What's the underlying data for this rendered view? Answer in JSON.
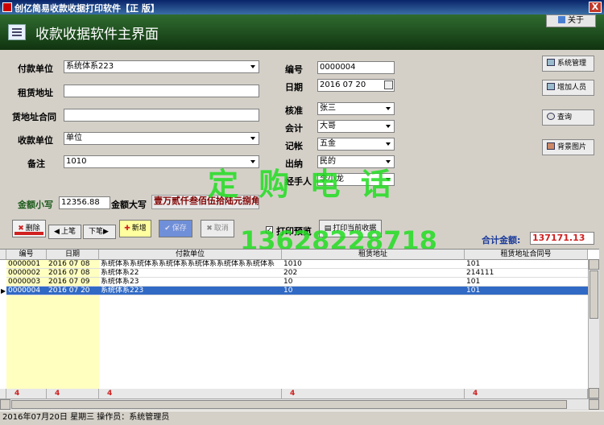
{
  "window": {
    "title": "创亿简易收款收据打印软件【正 版】",
    "close_label": "X"
  },
  "header": {
    "title": "收款收据软件主界面",
    "about_label": "关于"
  },
  "form": {
    "payer_label": "付款单位",
    "payer_value": "系统体系223",
    "rent_addr_label": "租赁地址",
    "rent_addr_value": "",
    "contract_label": "赁地址合同",
    "contract_value": "",
    "payee_label": "收款单位",
    "payee_value": "单位",
    "note_label": "备注",
    "note_value": "1010",
    "number_label": "编号",
    "number_value": "0000004",
    "date_label": "日期",
    "date_value": "2016  07  20",
    "approver_label": "核准",
    "approver_value": "张三",
    "accountant_label": "会计",
    "accountant_value": "大哥",
    "bookkeeper_label": "记帐",
    "bookkeeper_value": "五金",
    "cashier_label": "出纳",
    "cashier_value": "民的",
    "handler_label": "经手人",
    "handler_value": "李小龙",
    "amount_small_label": "金额小写",
    "amount_small_value": "12356.88",
    "amount_big_label": "金额大写",
    "amount_big_value": "壹万贰仟叁佰伍拾陆元捌角捌分"
  },
  "side_buttons": {
    "sys_admin": "系统管理",
    "add_user": "增加人员",
    "query": "查询",
    "bg_image": "背景图片"
  },
  "toolbar": {
    "delete_label": "删除",
    "prev_label": "上笔",
    "next_label": "下笔",
    "add_label": "新增",
    "save_label": "保存",
    "cancel_label": "取消",
    "print_preview_label": "打印预览",
    "print_current_label": "打印当前收据",
    "total_label": "合计金额:",
    "total_value": "137171.13"
  },
  "watermark": {
    "text1": "定 购 电 话",
    "text2": "13628228718"
  },
  "grid": {
    "columns": [
      "编号",
      "日期",
      "付款单位",
      "租赁地址",
      "租赁地址合同号"
    ],
    "rows": [
      [
        "0000001",
        "2016  07  08",
        "系统体系系统体系系统体系系统体系系统体系系统体系",
        "1010",
        "101"
      ],
      [
        "0000002",
        "2016  07  08",
        "系统体系22",
        "202",
        "214111"
      ],
      [
        "0000003",
        "2016  07  09",
        "系统体系23",
        "10",
        "101"
      ],
      [
        "0000004",
        "2016  07  20",
        "系统体系223",
        "10",
        "101"
      ]
    ],
    "selected_index": 3,
    "footer": [
      "4",
      "4",
      "4",
      "4",
      "4"
    ]
  },
  "status": {
    "text": "2016年07月20日   星期三   操作员：系统管理员"
  },
  "colors": {
    "header_green": "#1d4a1d",
    "selection": "#316ac5",
    "watermark": "#22dd22",
    "total_red": "#d02020"
  }
}
